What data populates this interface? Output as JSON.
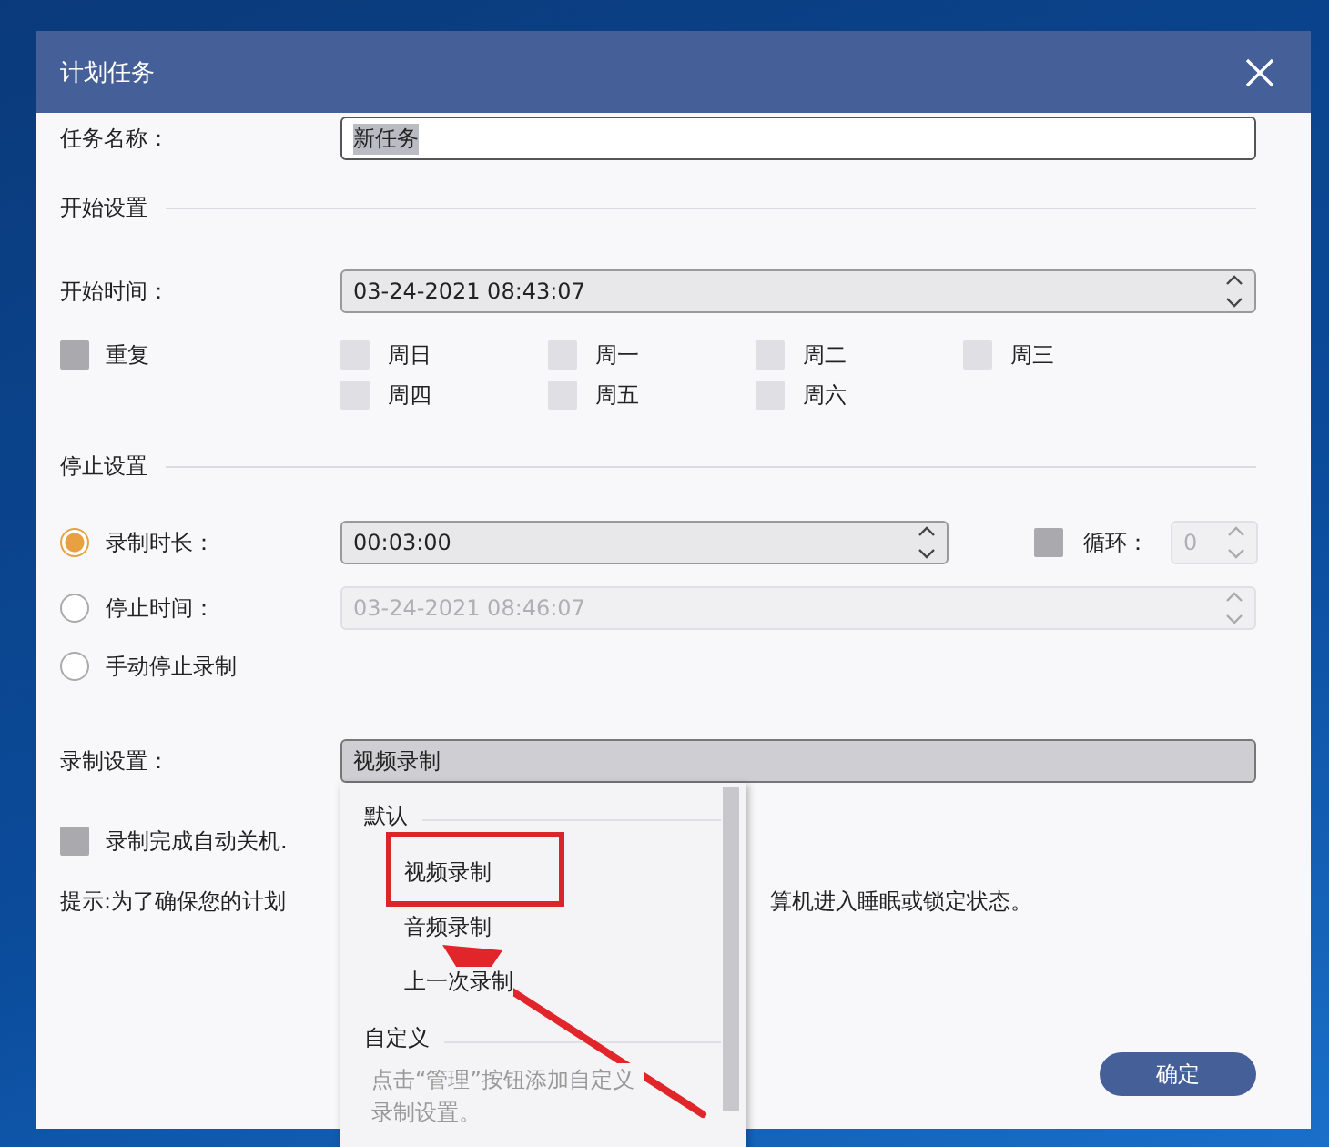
{
  "window": {
    "title": "计划任务"
  },
  "task_name": {
    "label": "任务名称：",
    "value": "新任务",
    "text_selected": true
  },
  "start_section": {
    "title": "开始设置",
    "start_time": {
      "label": "开始时间：",
      "value": "03-24-2021 08:43:07"
    },
    "repeat": {
      "label": "重复",
      "checked": false
    },
    "weekdays": [
      {
        "label": "周日",
        "checked": false
      },
      {
        "label": "周一",
        "checked": false
      },
      {
        "label": "周二",
        "checked": false
      },
      {
        "label": "周三",
        "checked": false
      },
      {
        "label": "周四",
        "checked": false
      },
      {
        "label": "周五",
        "checked": false
      },
      {
        "label": "周六",
        "checked": false
      }
    ]
  },
  "stop_section": {
    "title": "停止设置",
    "options": [
      {
        "kind": "duration",
        "label": "录制时长：",
        "selected": true,
        "value": "00:03:00"
      },
      {
        "kind": "time",
        "label": "停止时间：",
        "selected": false,
        "value": "03-24-2021 08:46:07"
      },
      {
        "kind": "manual",
        "label": "手动停止录制",
        "selected": false
      }
    ],
    "loop": {
      "label": "循环：",
      "checked": false,
      "value": "0"
    }
  },
  "record_settings": {
    "label": "录制设置：",
    "value": "视频录制",
    "dropdown": {
      "groups": [
        {
          "title": "默认",
          "items": [
            {
              "label": "视频录制"
            },
            {
              "label": "音频录制"
            },
            {
              "label": "上一次录制"
            }
          ]
        },
        {
          "title": "自定义",
          "note": "点击“管理”按钮添加自定义录制设置。"
        }
      ]
    }
  },
  "auto_shutdown": {
    "label": "录制完成自动关机.",
    "checked": false
  },
  "hint": [
    "提示:为了确保您的计划",
    "算机进入睡眠或锁定状态。"
  ],
  "buttons": [
    {
      "label": "确定"
    }
  ],
  "annotations": {
    "highlight_box": true,
    "arrow": true
  }
}
